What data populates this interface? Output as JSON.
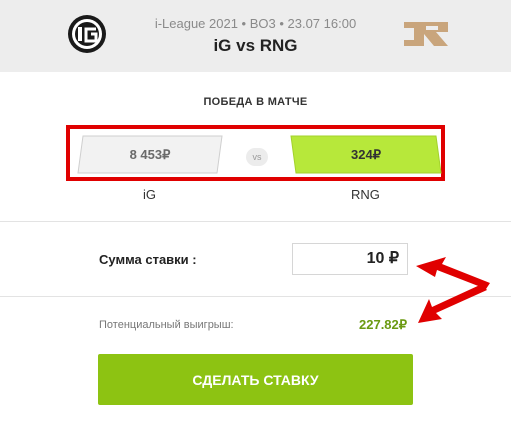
{
  "header": {
    "meta": "i-League 2021 • BO3 • 23.07 16:00",
    "title": "iG vs RNG",
    "team_left_logo": "ig-logo",
    "team_right_logo": "rng-logo"
  },
  "market": {
    "title": "ПОБЕДА В МАТЧЕ",
    "vs_label": "vs",
    "odds": [
      {
        "team": "iG",
        "value": "8 453₽",
        "selected": false
      },
      {
        "team": "RNG",
        "value": "324₽",
        "selected": true
      }
    ]
  },
  "stake": {
    "label": "Сумма ставки :",
    "value": "10 ₽"
  },
  "potential": {
    "label": "Потенциальный выигрыш:",
    "value": "227.82₽"
  },
  "button": {
    "label": "СДЕЛАТЬ СТАВКУ"
  },
  "colors": {
    "accent_green": "#8dc312",
    "selected_odd": "#b7e83a",
    "highlight_red": "#e00000",
    "win_green": "#6b9a12"
  }
}
